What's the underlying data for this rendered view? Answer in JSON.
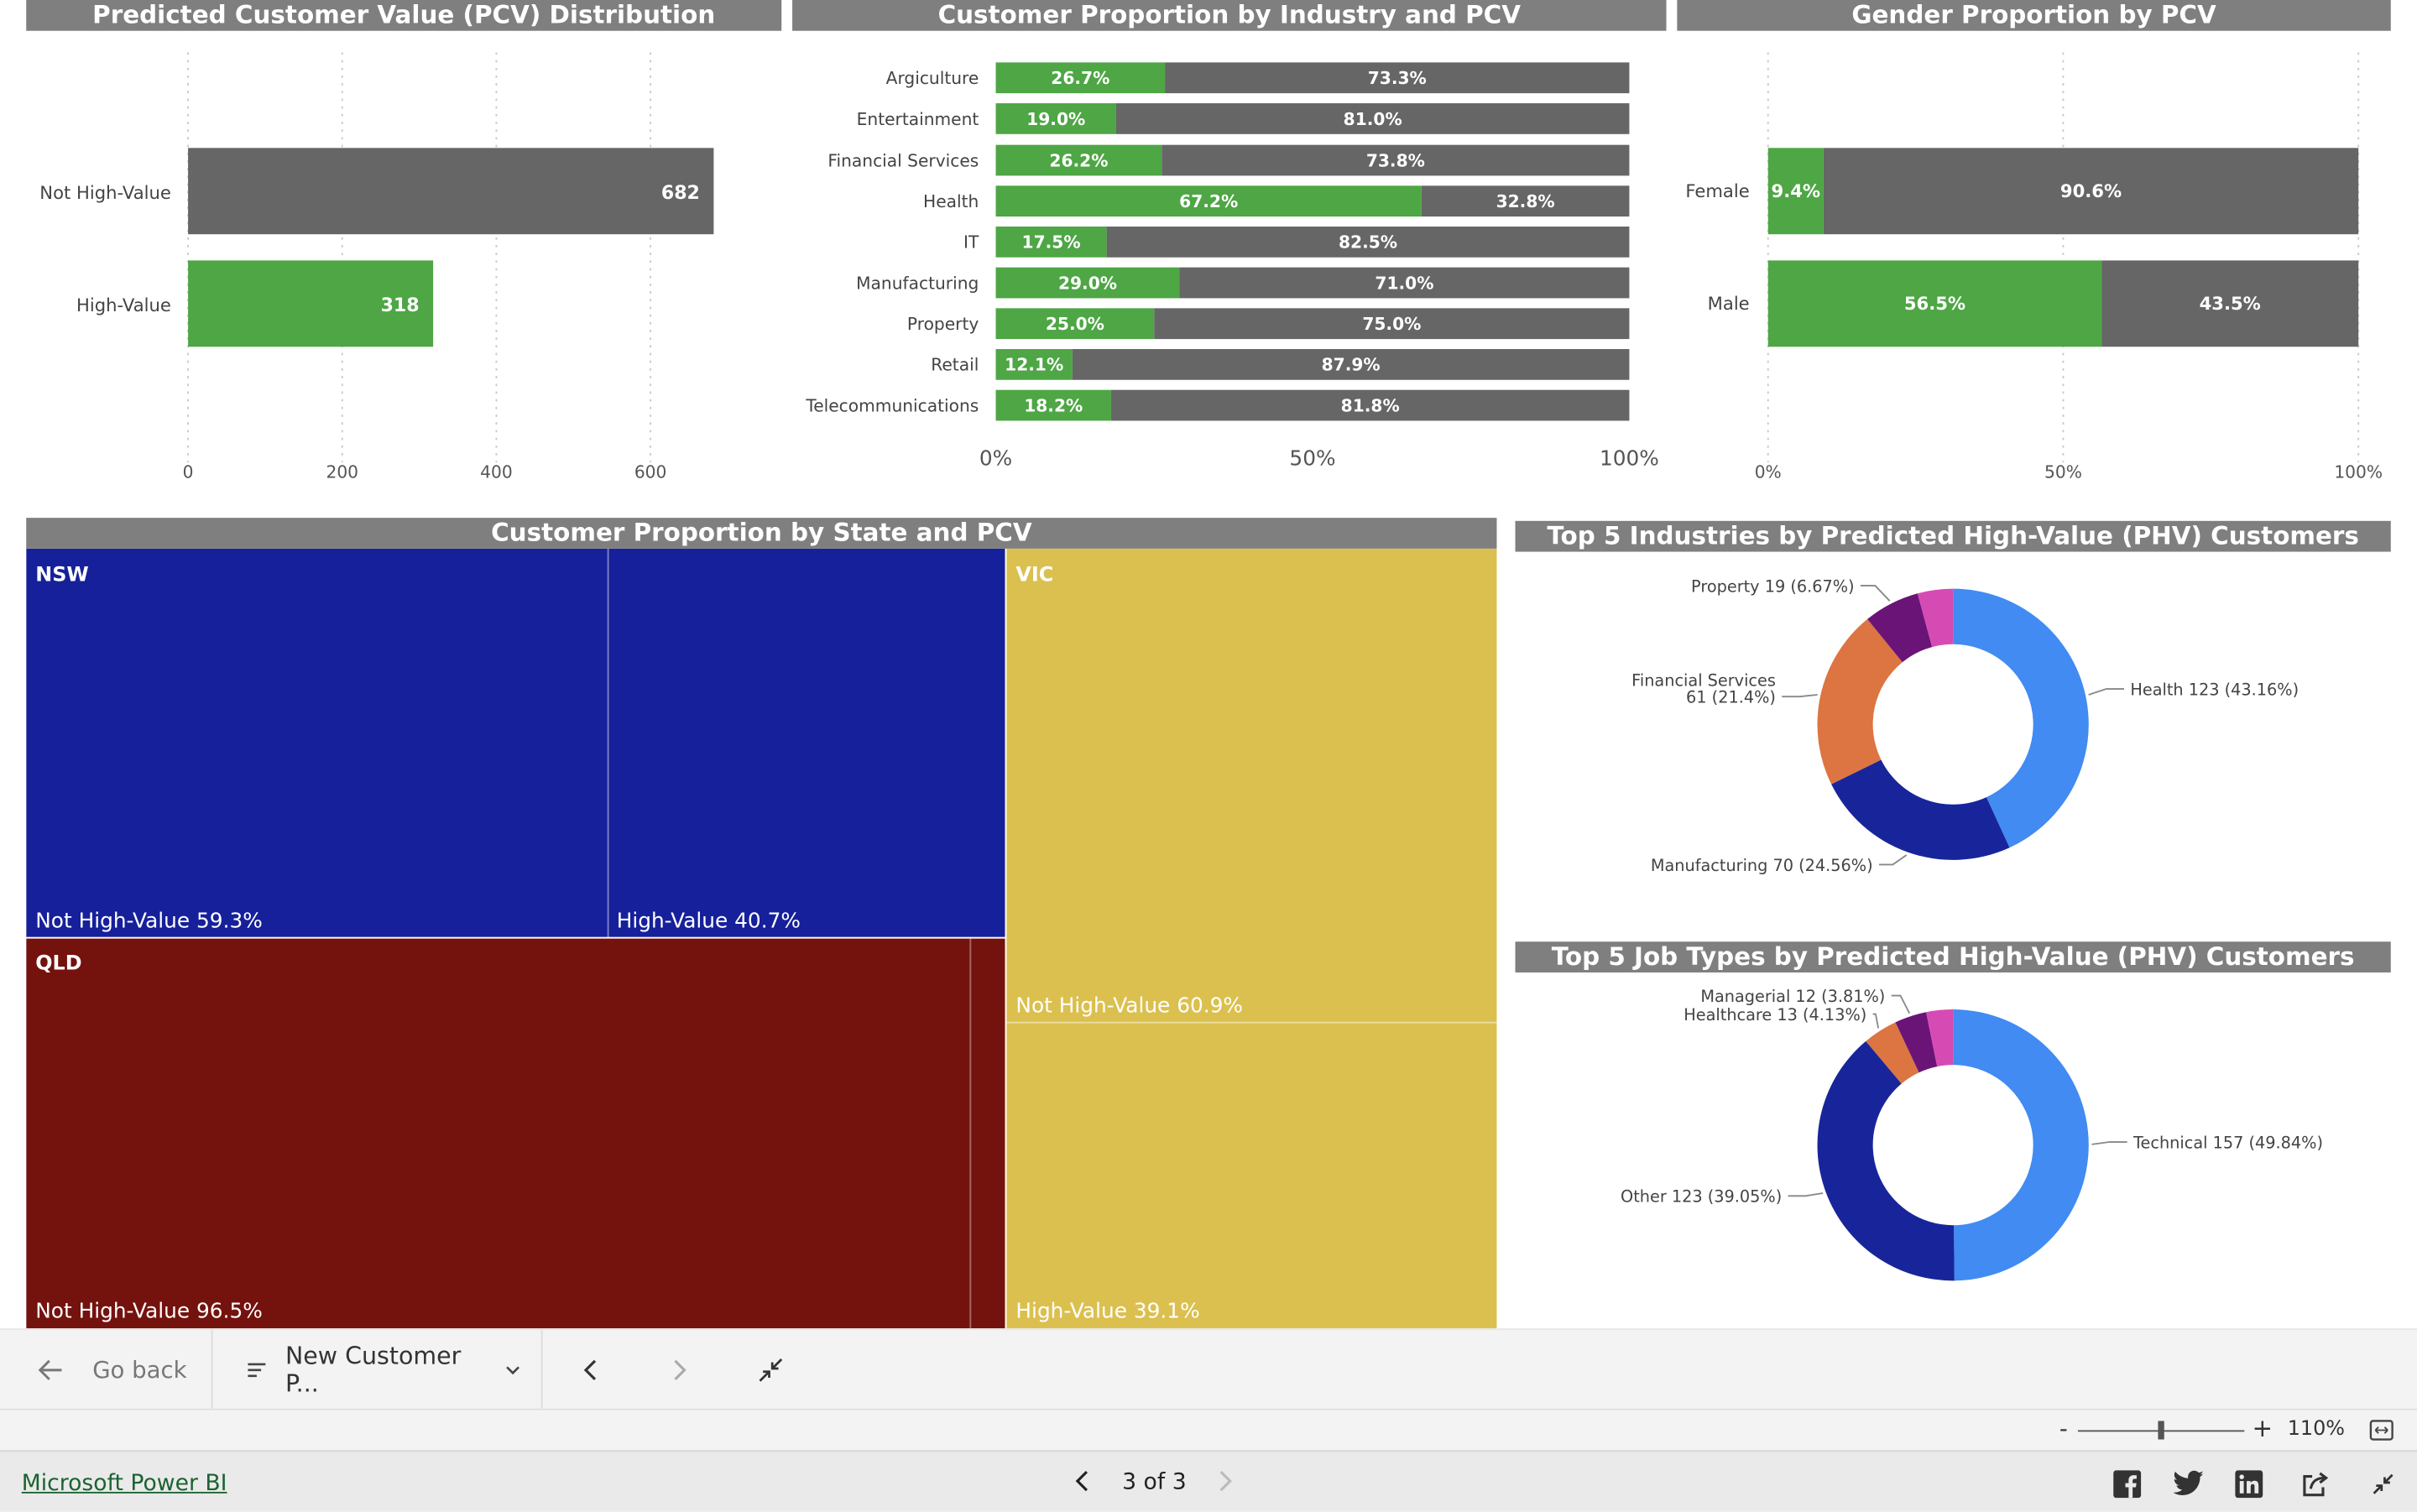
{
  "visuals": {
    "pcv_distribution": {
      "title": "Predicted Customer Value (PCV) Distribution",
      "chart_data": {
        "type": "bar",
        "orientation": "horizontal",
        "categories": [
          "Not High-Value",
          "High-Value"
        ],
        "values": [
          682,
          318
        ],
        "colors": [
          "#666666",
          "#4ea645"
        ],
        "x_ticks": [
          "0",
          "200",
          "400",
          "600"
        ],
        "xlim": [
          0,
          700
        ]
      }
    },
    "industry_pcv": {
      "title": "Customer Proportion by Industry and PCV",
      "chart_data": {
        "type": "bar",
        "stacked": "100%",
        "orientation": "horizontal",
        "categories": [
          "Argiculture",
          "Entertainment",
          "Financial Services",
          "Health",
          "IT",
          "Manufacturing",
          "Property",
          "Retail",
          "Telecommunications"
        ],
        "series": [
          {
            "values": [
              26.7,
              19.0,
              26.2,
              67.2,
              17.5,
              29.0,
              25.0,
              12.1,
              18.2
            ],
            "labels": [
              "26.7%",
              "19.0%",
              "26.2%",
              "67.2%",
              "17.5%",
              "29.0%",
              "25.0%",
              "12.1%",
              "18.2%"
            ],
            "color": "#4ea645"
          },
          {
            "values": [
              73.3,
              81.0,
              73.8,
              32.8,
              82.5,
              71.0,
              75.0,
              87.9,
              81.8
            ],
            "labels": [
              "73.3%",
              "81.0%",
              "73.8%",
              "32.8%",
              "82.5%",
              "71.0%",
              "75.0%",
              "87.9%",
              "81.8%"
            ],
            "color": "#666666"
          }
        ],
        "x_ticks": [
          "0%",
          "50%",
          "100%"
        ]
      }
    },
    "gender_pcv": {
      "title": "Gender Proportion by PCV",
      "chart_data": {
        "type": "bar",
        "stacked": "100%",
        "orientation": "horizontal",
        "categories": [
          "Female",
          "Male"
        ],
        "series": [
          {
            "values": [
              9.4,
              56.5
            ],
            "labels": [
              "9.4%",
              "56.5%"
            ],
            "color": "#4ea645"
          },
          {
            "values": [
              90.6,
              43.5
            ],
            "labels": [
              "90.6%",
              "43.5%"
            ],
            "color": "#666666"
          }
        ],
        "x_ticks": [
          "0%",
          "50%",
          "100%"
        ]
      }
    },
    "state_pcv": {
      "title": "Customer Proportion by State and PCV",
      "chart_data": {
        "type": "treemap",
        "groups": [
          {
            "state": "NSW",
            "color": "#16209a",
            "children": [
              {
                "label": "Not High-Value 59.3%",
                "value": 59.3
              },
              {
                "label": "High-Value 40.7%",
                "value": 40.7
              }
            ]
          },
          {
            "state": "VIC",
            "color": "#dbc04f",
            "children": [
              {
                "label": "Not High-Value 60.9%",
                "value": 60.9
              },
              {
                "label": "High-Value 39.1%",
                "value": 39.1
              }
            ]
          },
          {
            "state": "QLD",
            "color": "#74120e",
            "children": [
              {
                "label": "Not High-Value 96.5%",
                "value": 96.5
              },
              {
                "label": "",
                "value": 3.5
              }
            ]
          }
        ]
      }
    },
    "top_industries": {
      "title": "Top 5 Industries by Predicted High-Value (PHV) Customers",
      "chart_data": {
        "type": "donut",
        "slices": [
          {
            "value": 123,
            "label": "Health 123 (43.16%)",
            "color": "#418bf2"
          },
          {
            "value": 70,
            "label": "Manufacturing 70 (24.56%)",
            "color": "#18259a"
          },
          {
            "value": 61,
            "label": "Financial Services 61 (21.4%)",
            "label_lines": [
              "Financial Services",
              "61 (21.4%)"
            ],
            "color": "#dc7541"
          },
          {
            "value": 19,
            "label": "Property 19 (6.67%)",
            "color": "#6b1478"
          },
          {
            "value": 12,
            "label": "",
            "color": "#d64bb3"
          }
        ]
      }
    },
    "top_jobs": {
      "title": "Top 5 Job Types by Predicted High-Value (PHV) Customers",
      "chart_data": {
        "type": "donut",
        "slices": [
          {
            "value": 157,
            "label": "Technical 157 (49.84%)",
            "color": "#418bf2"
          },
          {
            "value": 123,
            "label": "Other 123 (39.05%)",
            "color": "#18259a"
          },
          {
            "value": 13,
            "label": "Healthcare 13 (4.13%)",
            "color": "#dc7541"
          },
          {
            "value": 12,
            "label": "Managerial 12 (3.81%)",
            "color": "#6b1478"
          },
          {
            "value": 10,
            "label": "",
            "color": "#d64bb3"
          }
        ]
      }
    }
  },
  "nav": {
    "go_back": "Go back",
    "page_dropdown": "New Customer P...",
    "back_arrow_icon": "arrow-left-icon",
    "list_icon": "lines-icon",
    "chevron_icon": "chevron-down-icon",
    "prev_icon": "chevron-left-icon",
    "next_icon": "chevron-right-icon",
    "collapse_icon": "collapse-arrows-icon"
  },
  "zoom": {
    "minus": "-",
    "plus": "+",
    "value_label": "110%",
    "slider_level": 0.5,
    "fit_icon": "fit-page-icon"
  },
  "footer": {
    "brand_link": "Microsoft Power BI",
    "page_indicator": "3 of 3",
    "icons": [
      "facebook-icon",
      "twitter-icon",
      "linkedin-icon",
      "share-icon",
      "fullscreen-exit-icon"
    ]
  }
}
